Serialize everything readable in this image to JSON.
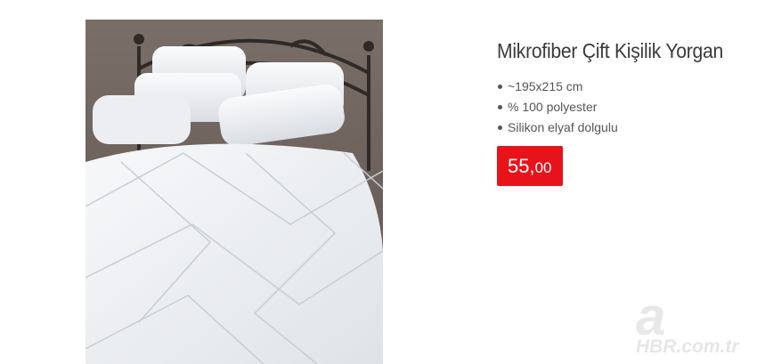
{
  "product": {
    "title": "Mikrofiber Çift Kişilik Yorgan",
    "features": [
      "~195x215 cm",
      "% 100 polyester",
      "Silikon elyaf dolgulu"
    ],
    "price_main": "55,",
    "price_cents": "00"
  },
  "watermark": {
    "letter": "a",
    "text": "HBR.com.tr"
  },
  "colors": {
    "price_bg": "#e8121b",
    "title": "#3a3a3a"
  }
}
